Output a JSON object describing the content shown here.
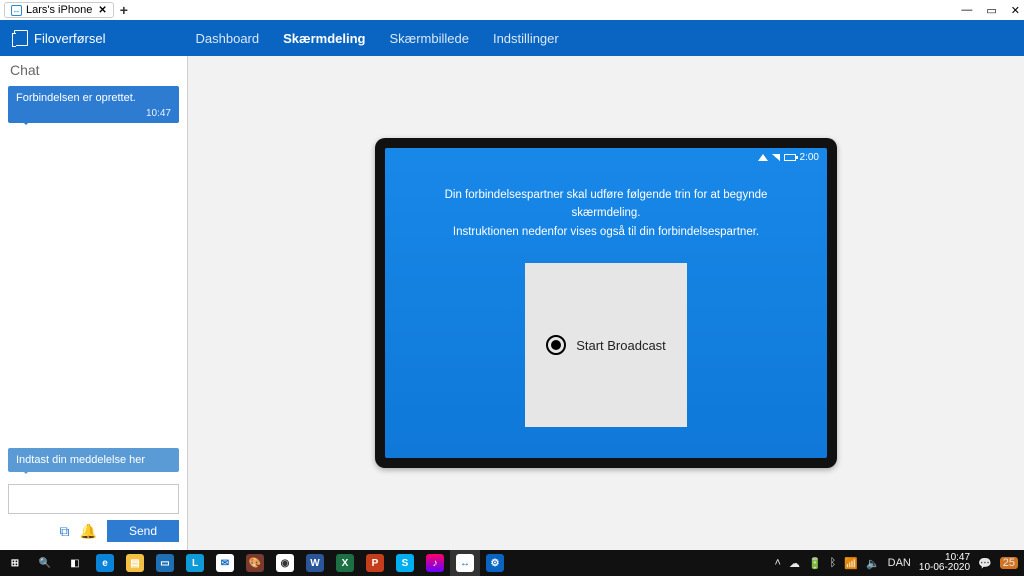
{
  "window": {
    "tab_title": "Lars's iPhone",
    "controls": {
      "minimize": "—",
      "maximize": "▭",
      "close": "✕"
    }
  },
  "toolbar": {
    "brand": "Filoverførsel",
    "nav": {
      "dashboard": "Dashboard",
      "skaermdeling": "Skærmdeling",
      "skaermbillede": "Skærmbillede",
      "indstillinger": "Indstillinger"
    }
  },
  "chat": {
    "title": "Chat",
    "message": {
      "text": "Forbindelsen er oprettet.",
      "time": "10:47"
    },
    "hint": "Indtast din meddelelse her",
    "send_label": "Send"
  },
  "screen": {
    "status_time": "2:00",
    "instruction_line1": "Din forbindelsespartner skal udføre følgende trin for at begynde skærmdeling.",
    "instruction_line2": "Instruktionen nedenfor vises også til din forbindelsespartner.",
    "broadcast_label": "Start Broadcast"
  },
  "taskbar": {
    "lang": "DAN",
    "time": "10:47",
    "date": "10-06-2020",
    "notification_count": "25"
  }
}
